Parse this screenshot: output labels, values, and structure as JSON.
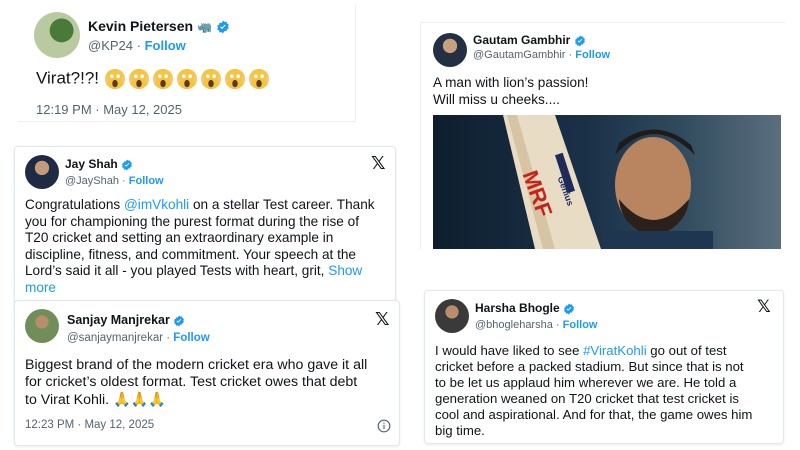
{
  "pietersen": {
    "name": "Kevin Pietersen",
    "handle": "@KP24",
    "follow": "Follow",
    "text": "Virat?!?!",
    "emoji_count": 7,
    "time": "12:19 PM · May 12, 2025"
  },
  "gambhir": {
    "name": "Gautam Gambhir",
    "handle": "@GautamGambhir",
    "follow": "Follow",
    "text_line1": "A man with lion’s passion!",
    "text_line2": "Will miss u cheeks....",
    "photo_bat_text": "MRF",
    "photo_bat_sub": "Genius"
  },
  "shah": {
    "name": "Jay Shah",
    "handle": "@JayShah",
    "follow": "Follow",
    "line1_pre": "Congratulations ",
    "line1_mention": "@imVkohli",
    "line1_post": " on a stellar Test career. Thank",
    "line2": "you for championing the purest format during the rise of",
    "line3": "T20 cricket and setting an extraordinary example in",
    "line4": "discipline, fitness, and commitment. Your speech at the",
    "line5_pre": "Lord’s said it all - you played Tests with heart, grit, ",
    "line5_show": "Show",
    "line6": "more"
  },
  "manjrekar": {
    "name": "Sanjay Manjrekar",
    "handle": "@sanjaymanjrekar",
    "follow": "Follow",
    "line1": "Biggest brand of the modern cricket era who gave it all",
    "line2": "for cricket’s oldest format. Test cricket owes that debt",
    "line3": "to Virat Kohli. 🙏🙏🙏",
    "time": "12:23 PM · May 12, 2025"
  },
  "bhogle": {
    "name": "Harsha Bhogle",
    "handle": "@bhogleharsha",
    "follow": "Follow",
    "line1_pre": "I would have liked to see ",
    "line1_tag": "#ViratKohli",
    "line1_post": " go out of test",
    "line2": "cricket before a packed stadium. But since that is not",
    "line3": "to be let us applaud him wherever we are. He told a",
    "line4": "generation weaned on T20 cricket that test cricket is",
    "line5": "cool and aspirational. And for that, the game owes him",
    "line6": "big time."
  },
  "colors": {
    "accent": "#1d9bf0",
    "text": "#0f1419",
    "muted": "#536471"
  }
}
